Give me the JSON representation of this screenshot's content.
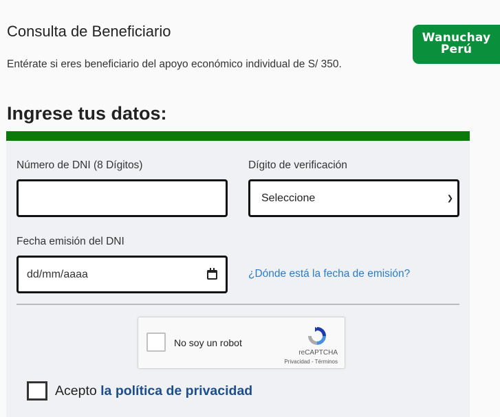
{
  "header": {
    "title": "Consulta de Beneficiario",
    "description": "Entérate si eres beneficiario del apoyo económico individual de S/ 350.",
    "logo_line1": "Wanuchay",
    "logo_line2": "Perú",
    "brand_color": "#0a8f3c"
  },
  "form": {
    "heading": "Ingrese tus datos:",
    "bar_color": "#0b7a0b",
    "dni": {
      "label": "Número de DNI (8 Dígitos)",
      "value": ""
    },
    "check_digit": {
      "label": "Dígito de verificación",
      "selected": "Seleccione"
    },
    "issue_date": {
      "label": "Fecha emisión del DNI",
      "placeholder": "dd/mm/aaaa"
    },
    "help_link": "¿Dónde está la fecha de emisión?",
    "captcha": {
      "label": "No soy un robot",
      "brand": "reCAPTCHA",
      "terms": "Privacidad - Términos"
    },
    "accept": {
      "prefix": "Acepto ",
      "link": "la política de privacidad"
    }
  }
}
